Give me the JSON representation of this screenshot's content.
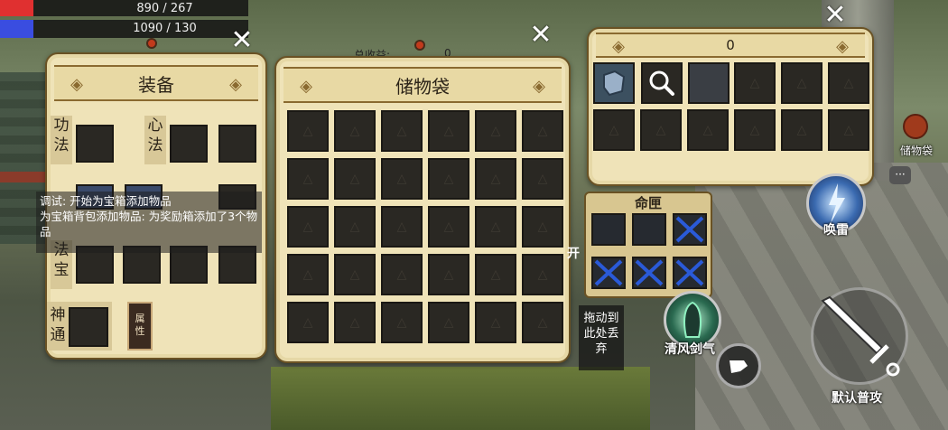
{
  "hud": {
    "hp_text": "890 / 267",
    "mp_text": "1090 / 130",
    "hp_color": "#e03030",
    "mp_color": "#3a4de0"
  },
  "equipment": {
    "title": "装备",
    "row_labels": [
      "功\n法",
      "心\n法",
      "法\n宝",
      "神\n通"
    ],
    "attr_button": "属\n性"
  },
  "storage": {
    "total_label": "总收益:",
    "total_value": "0",
    "title": "储物袋"
  },
  "chest": {
    "count": "0",
    "item_icons": [
      "armor-item-icon",
      "magnifier-icon"
    ]
  },
  "debug": {
    "lines": [
      "调试: 开始为宝箱添加物品",
      "为宝箱背包添加物品: 为奖励箱添加了3个物品"
    ]
  },
  "fate": {
    "title": "命匣"
  },
  "drop": {
    "text": "拖动到此处丢弃",
    "open_label": "开"
  },
  "skills": {
    "storage_bag": "储物袋",
    "thunder": "唤雷",
    "wind_sword": "清风剑气",
    "default_attack": "默认普攻"
  }
}
